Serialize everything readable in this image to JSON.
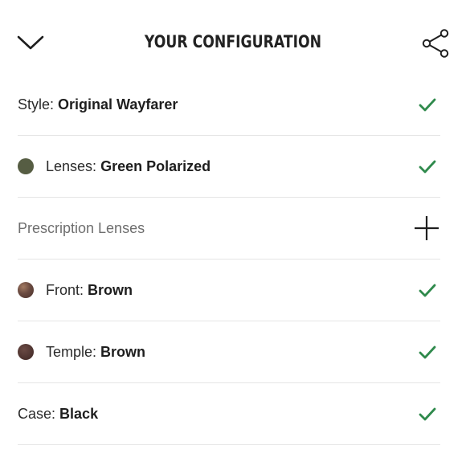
{
  "header": {
    "title": "YOUR CONFIGURATION",
    "collapse_icon": "chevron-down-icon",
    "share_icon": "share-icon"
  },
  "colors": {
    "check": "#2f8a4c",
    "lens_green": "#565d43",
    "brown_front": "#5a3f38",
    "brown_temple": "#4f3430",
    "divider": "#e5e5e5"
  },
  "rows": [
    {
      "label": "Style:",
      "value": "Original Wayfarer",
      "status_icon": "check-icon"
    },
    {
      "label": "Lenses:",
      "value": "Green Polarized",
      "status_icon": "check-icon",
      "swatch": "lens_green"
    },
    {
      "label": "Prescription Lenses",
      "value": "",
      "status_icon": "plus-icon"
    },
    {
      "label": "Front:",
      "value": "Brown",
      "status_icon": "check-icon",
      "swatch": "brown_front"
    },
    {
      "label": "Temple:",
      "value": "Brown",
      "status_icon": "check-icon",
      "swatch": "brown_temple"
    },
    {
      "label": "Case:",
      "value": "Black",
      "status_icon": "check-icon"
    }
  ]
}
